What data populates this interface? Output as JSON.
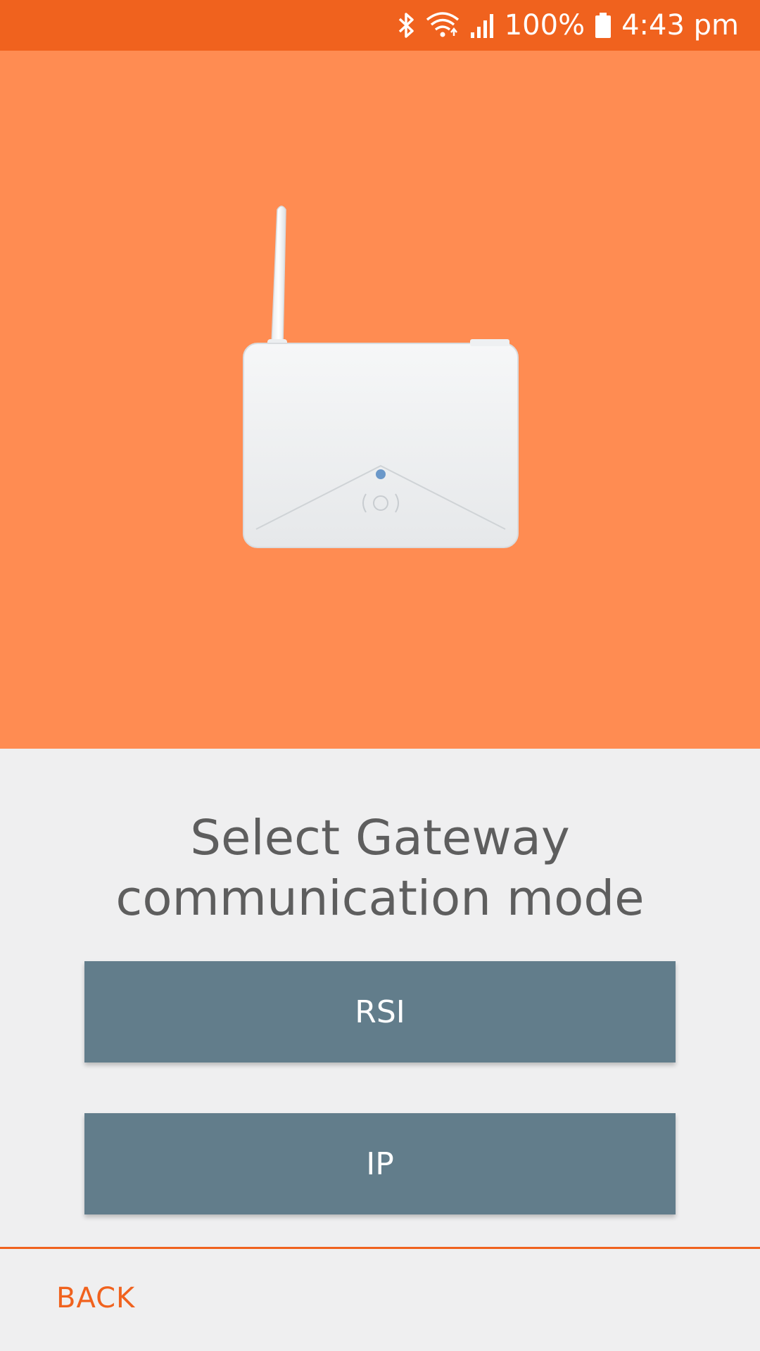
{
  "status_bar": {
    "battery_percent": "100%",
    "time": "4:43 pm",
    "icons": [
      "bluetooth-icon",
      "wifi-icon",
      "signal-icon",
      "battery-icon"
    ]
  },
  "hero": {
    "image": "gateway-device-illustration"
  },
  "main": {
    "title_line1": "Select Gateway",
    "title_line2": "communication mode",
    "options": [
      {
        "label": "RSI"
      },
      {
        "label": "IP"
      }
    ]
  },
  "footer": {
    "back_label": "BACK"
  },
  "colors": {
    "status_bar": "#f0621e",
    "hero_bg": "#ff8c52",
    "button": "#627d8b",
    "accent": "#f0621e",
    "page_bg": "#efeff0"
  }
}
